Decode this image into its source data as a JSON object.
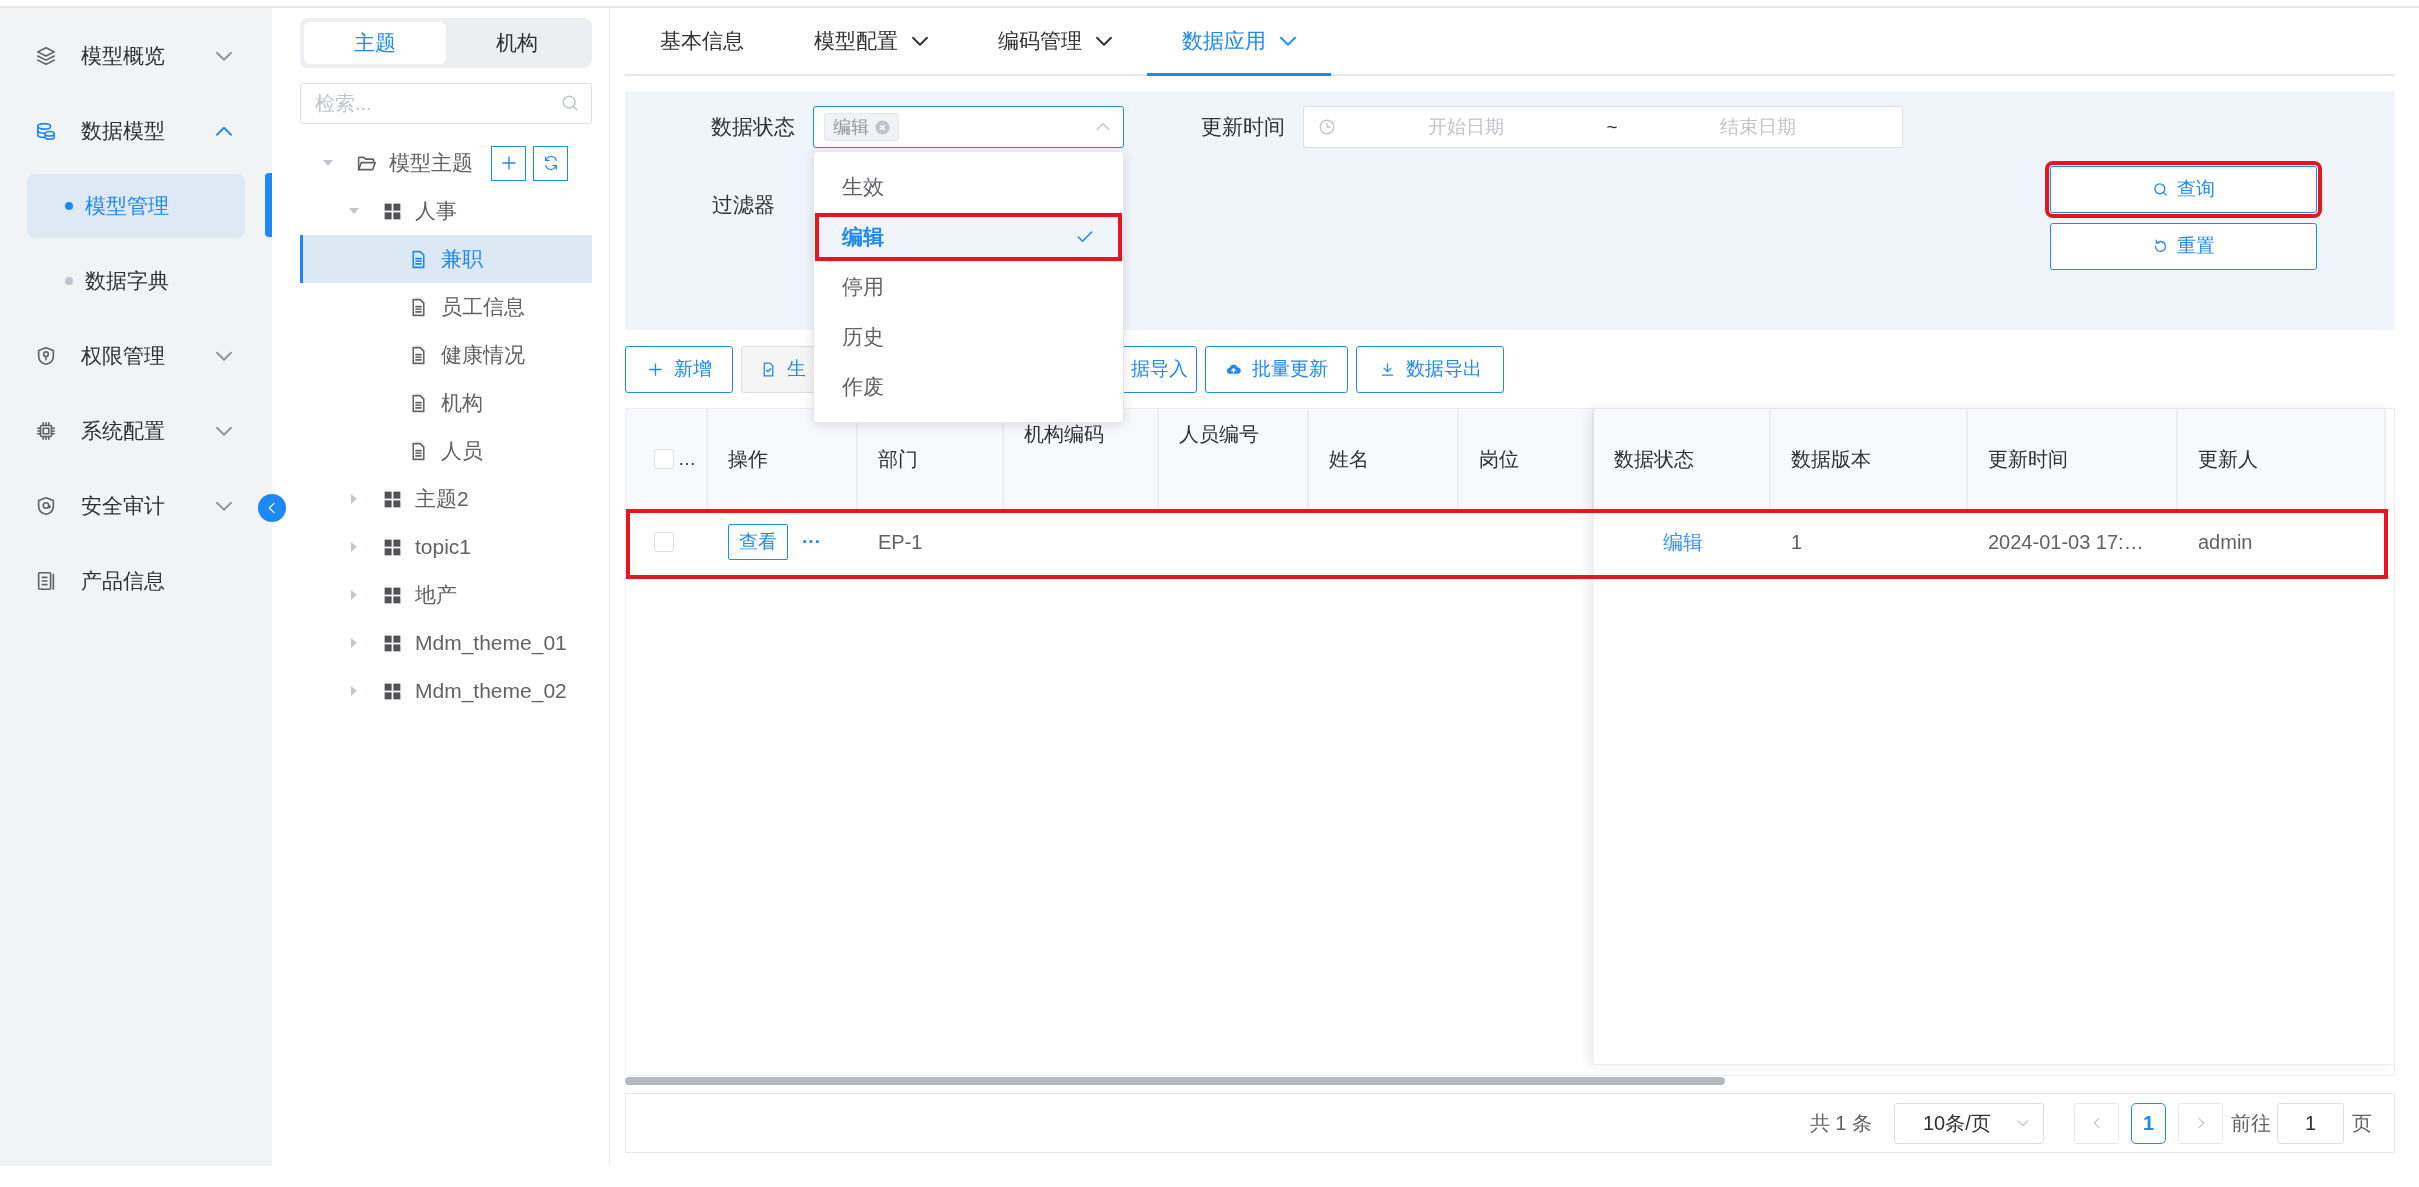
{
  "nav": {
    "items": [
      {
        "label": "模型概览",
        "expanded": false
      },
      {
        "label": "数据模型",
        "expanded": true,
        "children": [
          {
            "label": "模型管理",
            "selected": true
          },
          {
            "label": "数据字典",
            "selected": false
          }
        ]
      },
      {
        "label": "权限管理",
        "expanded": false
      },
      {
        "label": "系统配置",
        "expanded": false
      },
      {
        "label": "安全审计",
        "expanded": false
      },
      {
        "label": "产品信息"
      }
    ]
  },
  "tree_panel": {
    "tabs": [
      {
        "label": "主题",
        "selected": true
      },
      {
        "label": "机构",
        "selected": false
      }
    ],
    "search": {
      "placeholder": "检索..."
    },
    "tree": [
      {
        "kind": "folder",
        "label": "模型主题",
        "expanded": true,
        "children": [
          {
            "kind": "group",
            "label": "人事",
            "expanded": true,
            "children": [
              {
                "kind": "doc",
                "label": "兼职",
                "selected": true
              },
              {
                "kind": "doc",
                "label": "员工信息",
                "selected": false
              },
              {
                "kind": "doc",
                "label": "健康情况",
                "selected": false
              },
              {
                "kind": "doc",
                "label": "机构",
                "selected": false
              },
              {
                "kind": "doc",
                "label": "人员",
                "selected": false
              }
            ]
          },
          {
            "kind": "group",
            "label": "主题2",
            "expanded": false
          },
          {
            "kind": "group",
            "label": "topic1",
            "expanded": false
          },
          {
            "kind": "group",
            "label": "地产",
            "expanded": false
          },
          {
            "kind": "group",
            "label": "Mdm_theme_01",
            "expanded": false
          },
          {
            "kind": "group",
            "label": "Mdm_theme_02",
            "expanded": false
          }
        ]
      }
    ]
  },
  "tabs": [
    {
      "label": "基本信息",
      "selected": false,
      "menu": false
    },
    {
      "label": "模型配置",
      "selected": false,
      "menu": true
    },
    {
      "label": "编码管理",
      "selected": false,
      "menu": true
    },
    {
      "label": "数据应用",
      "selected": true,
      "menu": true
    }
  ],
  "filter": {
    "status": {
      "label": "数据状态",
      "tags": [
        "编辑"
      ],
      "open": true,
      "options": [
        {
          "label": "生效",
          "selected": false,
          "annotated": false
        },
        {
          "label": "编辑",
          "selected": true,
          "annotated": true
        },
        {
          "label": "停用",
          "selected": false,
          "annotated": false
        },
        {
          "label": "历史",
          "selected": false,
          "annotated": false
        },
        {
          "label": "作废",
          "selected": false,
          "annotated": false
        }
      ]
    },
    "date": {
      "label": "更新时间",
      "start_placeholder": "开始日期",
      "separator": "~",
      "end_placeholder": "结束日期"
    },
    "filter_label": "过滤器",
    "buttons": [
      {
        "kind": "search",
        "label": "查询",
        "annotated": true
      },
      {
        "kind": "reset",
        "label": "重置",
        "annotated": false
      }
    ]
  },
  "toolbar": [
    {
      "kind": "add",
      "label": "新增",
      "disabled": false
    },
    {
      "kind": "check",
      "label": "生",
      "disabled": true
    },
    {
      "kind": "none",
      "label": "据导入",
      "disabled": false
    },
    {
      "kind": "upload",
      "label": "批量更新",
      "disabled": false
    },
    {
      "kind": "download",
      "label": "数据导出",
      "disabled": false
    }
  ],
  "table": {
    "select_all": {
      "checked": false,
      "label": "…"
    },
    "columns": [
      {
        "label": "操作"
      },
      {
        "label": "部门"
      },
      {
        "label": "机构编码"
      },
      {
        "label": "人员编号"
      },
      {
        "label": "姓名"
      },
      {
        "label": "岗位"
      },
      {
        "label": "数据状态"
      },
      {
        "label": "数据版本"
      },
      {
        "label": "更新时间"
      },
      {
        "label": "更新人"
      }
    ],
    "rows": [
      {
        "checked": false,
        "annotated": true,
        "actions": {
          "view": "查看",
          "more": "···"
        },
        "department": "EP-1",
        "data_status": "编辑",
        "data_version": "1",
        "updated_at": "2024-01-03 17:…",
        "updated_by": "admin"
      }
    ]
  },
  "pagination": {
    "total": "共 1 条",
    "page_size": "10条/页",
    "pages": [
      {
        "label": "1",
        "selected": true
      }
    ],
    "goto_label": "前往",
    "goto_value": "1",
    "suffix": "页"
  }
}
